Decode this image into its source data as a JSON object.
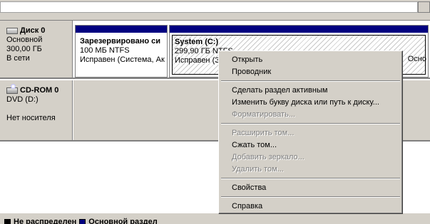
{
  "disks": [
    {
      "title": "Диск 0",
      "type": "Основной",
      "size": "300,00 ГБ",
      "status": "В сети",
      "partitions": [
        {
          "name": "Зарезервировано си",
          "size": "100 МБ NTFS",
          "status": "Исправен (Система, Ак"
        },
        {
          "name": "System  (C:)",
          "size": "299,90 ГБ NTFS",
          "status": "Исправен (З",
          "status_tail": "Осно"
        }
      ]
    },
    {
      "title": "CD-ROM 0",
      "type": "DVD (D:)",
      "status": "Нет носителя"
    }
  ],
  "legend": [
    {
      "label": "Не распределен",
      "color": "#000000"
    },
    {
      "label": "Основной раздел",
      "color": "#000080"
    }
  ],
  "context_menu": {
    "items": [
      {
        "label": "Открыть",
        "enabled": true
      },
      {
        "label": "Проводник",
        "enabled": true
      },
      {
        "label": "Сделать раздел активным",
        "enabled": true
      },
      {
        "label": "Изменить букву диска или путь к диску...",
        "enabled": true
      },
      {
        "label": "Форматировать...",
        "enabled": false
      },
      {
        "label": "Расширить том...",
        "enabled": false
      },
      {
        "label": "Сжать том...",
        "enabled": true
      },
      {
        "label": "Добавить зеркало...",
        "enabled": false
      },
      {
        "label": "Удалить том...",
        "enabled": false
      },
      {
        "label": "Свойства",
        "enabled": true
      },
      {
        "label": "Справка",
        "enabled": true
      }
    ]
  },
  "colors": {
    "primary_partition": "#000080",
    "unallocated": "#000000",
    "background": "#d4d0c8"
  }
}
